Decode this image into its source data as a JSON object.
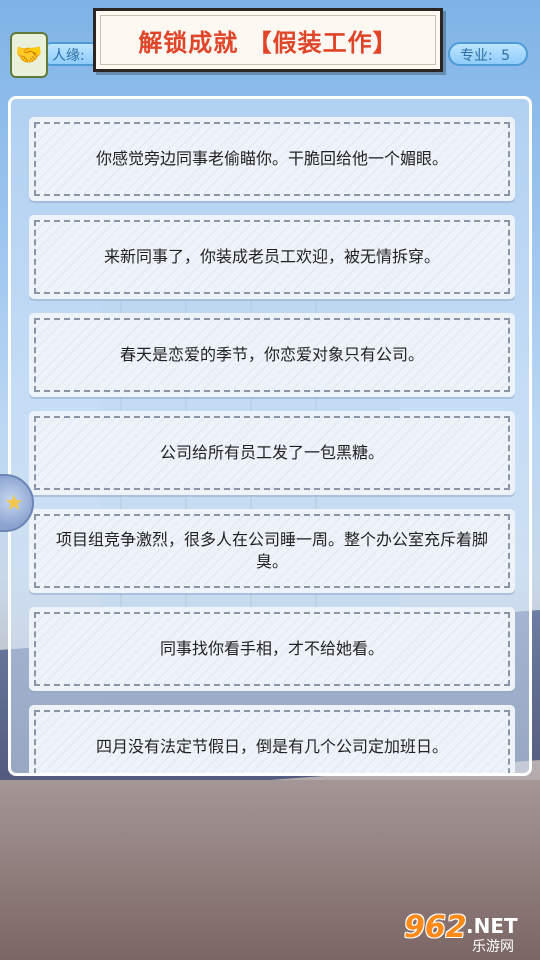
{
  "header": {
    "title": "解锁成就 【假装工作】",
    "renyuan_label": "人缘:",
    "renyuan_value": "",
    "zhuanye_label": "专业:",
    "zhuanye_value": "5"
  },
  "achievements": [
    "你感觉旁边同事老偷瞄你。干脆回给他一个媚眼。",
    "来新同事了，你装成老员工欢迎，被无情拆穿。",
    "春天是恋爱的季节，你恋爱对象只有公司。",
    "公司给所有员工发了一包黑糖。",
    "项目组竞争激烈，很多人在公司睡一周。整个办公室充斥着脚臭。",
    "同事找你看手相，才不给她看。",
    "四月没有法定节假日，倒是有几个公司定加班日。"
  ],
  "icons": {
    "handshake": "handshake-icon",
    "side": "star-icon"
  },
  "watermark": {
    "number": "962",
    "domain": ".NET",
    "name": "乐游网"
  }
}
